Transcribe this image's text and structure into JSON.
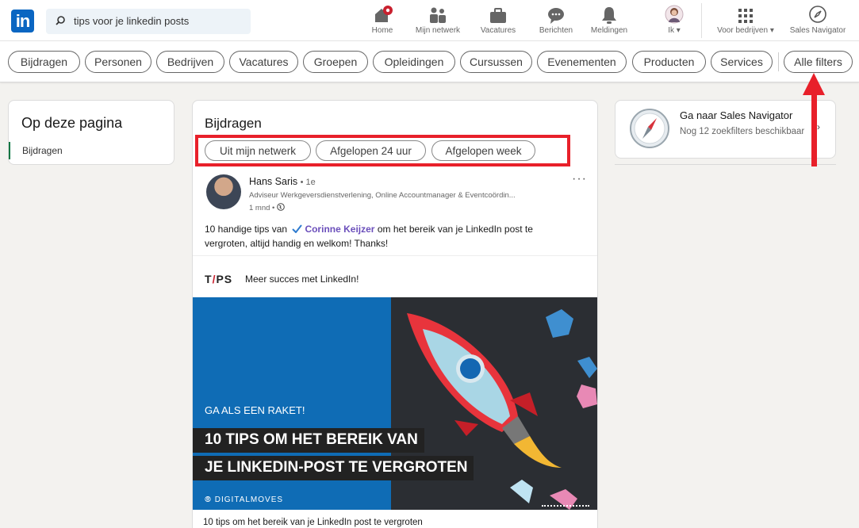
{
  "colors": {
    "brand": "#0a66c2",
    "annotation": "#e8202a",
    "mention": "#6b4fbb",
    "hero_blue": "#0f6cb5"
  },
  "header": {
    "logo": "in",
    "search_value": "tips voor je linkedin posts",
    "nav": [
      {
        "label": "Home",
        "icon": "home-icon"
      },
      {
        "label": "Mijn netwerk",
        "icon": "network-icon"
      },
      {
        "label": "Vacatures",
        "icon": "briefcase-icon"
      },
      {
        "label": "Berichten",
        "icon": "messaging-icon"
      },
      {
        "label": "Meldingen",
        "icon": "bell-icon"
      },
      {
        "label": "Ik",
        "icon": "profile-avatar"
      },
      {
        "label": "Voor bedrijven",
        "icon": "grid-icon"
      },
      {
        "label": "Sales Navigator",
        "icon": "compass-icon"
      }
    ]
  },
  "filters": [
    "Bijdragen",
    "Personen",
    "Bedrijven",
    "Vacatures",
    "Groepen",
    "Opleidingen",
    "Cursussen",
    "Evenementen",
    "Producten",
    "Services",
    "Alle filters"
  ],
  "sidebar": {
    "title": "Op deze pagina",
    "active_item": "Bijdragen"
  },
  "main": {
    "title": "Bijdragen",
    "subfilters": [
      "Uit mijn netwerk",
      "Afgelopen 24 uur",
      "Afgelopen week"
    ],
    "post": {
      "author": "Hans Saris",
      "degree": "• 1e",
      "headline": "Adviseur Werkgeversdienstverlening, Online Accountmanager & Eventcoördin...",
      "age": "1 mnd •",
      "text_before": "10 handige tips van",
      "mention": "Corinne Keijzer",
      "text_after": "om het bereik van je LinkedIn post te vergroten, altijd handig en welkom! Thanks!",
      "link_logo": "TIPS",
      "link_title": "Meer succes met LinkedIn!",
      "hero_kicker": "GA ALS EEN RAKET!",
      "hero_line1": "10 TIPS OM HET BEREIK VAN",
      "hero_line2": "JE LINKEDIN-POST TE VERGROTEN",
      "hero_brand": "DIGITALMOVES",
      "caption": "10 tips om het bereik van je LinkedIn post te vergroten"
    }
  },
  "right": {
    "title": "Ga naar Sales Navigator",
    "subtitle": "Nog 12 zoekfilters beschikbaar"
  }
}
